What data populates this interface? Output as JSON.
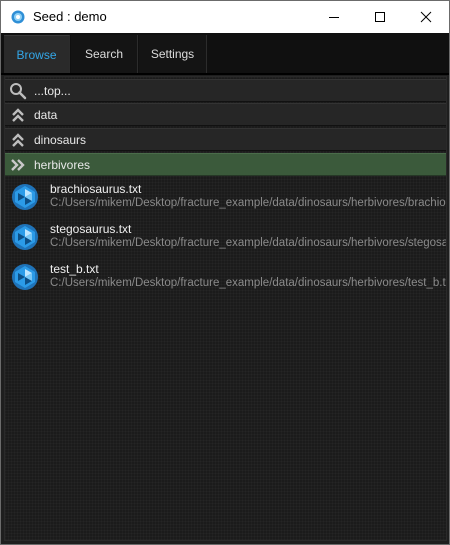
{
  "window": {
    "title": "Seed : demo",
    "accent": "#33a7e8"
  },
  "tabs": [
    {
      "label": "Browse",
      "active": true
    },
    {
      "label": "Search",
      "active": false
    },
    {
      "label": "Settings",
      "active": false
    }
  ],
  "browser": {
    "nav_rows": [
      {
        "label": "...top...",
        "icon": "search-icon"
      },
      {
        "label": "data",
        "icon": "chevron-up-double-icon"
      },
      {
        "label": "dinosaurs",
        "icon": "chevron-up-double-icon"
      },
      {
        "label": "herbivores",
        "icon": "chevron-right-double-icon",
        "selected": true,
        "color": "#3b5a3b"
      }
    ],
    "files": [
      {
        "name": "brachiosaurus.txt",
        "path": "C:/Users/mikem/Desktop/fracture_example/data/dinosaurs/herbivores/brachiosaurus.txt"
      },
      {
        "name": "stegosaurus.txt",
        "path": "C:/Users/mikem/Desktop/fracture_example/data/dinosaurs/herbivores/stegosaurus.txt"
      },
      {
        "name": "test_b.txt",
        "path": "C:/Users/mikem/Desktop/fracture_example/data/dinosaurs/herbivores/test_b.txt"
      }
    ]
  }
}
